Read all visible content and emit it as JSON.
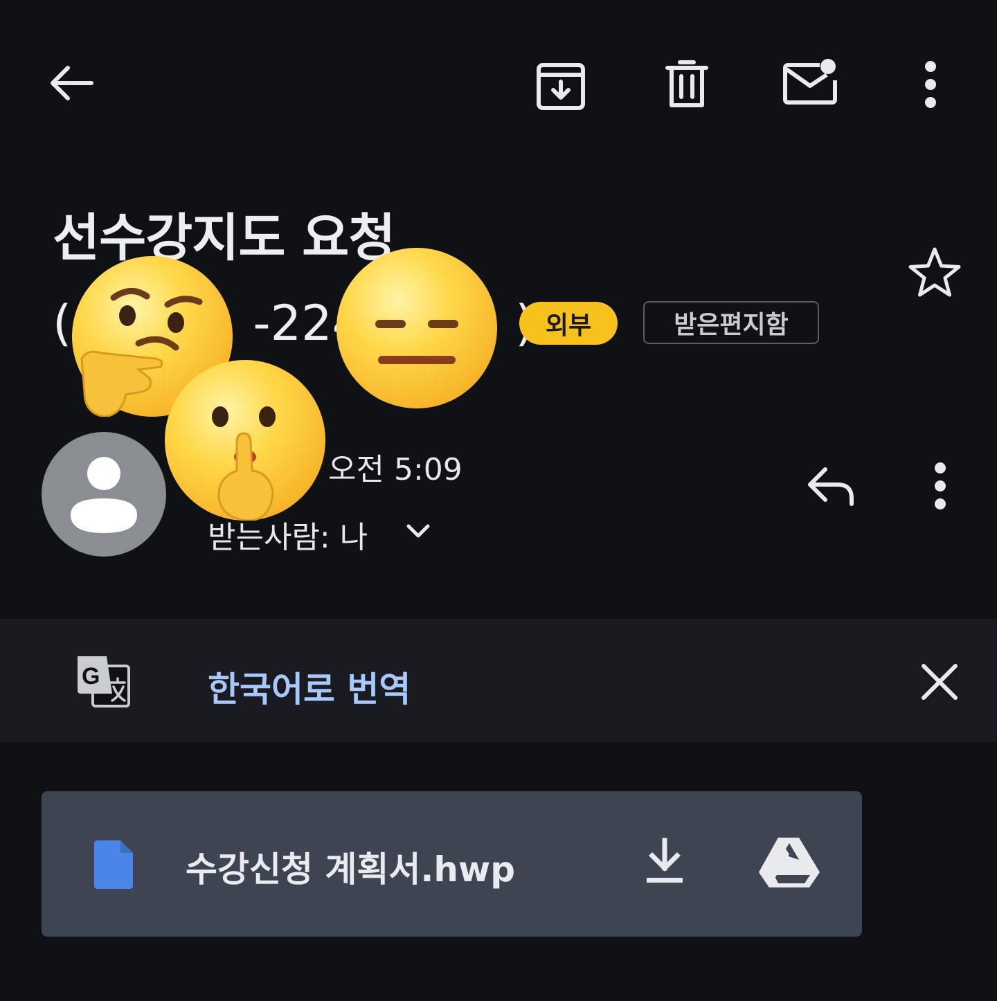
{
  "toolbar": {
    "back_icon": "arrow-back-icon",
    "archive_icon": "archive-icon",
    "delete_icon": "trash-icon",
    "mark_unread_icon": "mark-unread-icon",
    "more_icon": "more-vert-icon"
  },
  "email": {
    "subject_line1": "선수강지도 요청",
    "subject_part_open": "(",
    "subject_part_mid": "-224",
    "subject_part_close": ")",
    "badge_external": "외부",
    "badge_folder": "받은편지함",
    "starred": false
  },
  "message": {
    "time": "오전 5:09",
    "recipient": "받는사람: 나"
  },
  "translate": {
    "label": "한국어로 번역"
  },
  "attachment": {
    "file_name": "수강신청 계획서.hwp"
  },
  "colors": {
    "background": "#0f1115",
    "badge_external": "#f7c21b",
    "link_blue": "#a8c7fa",
    "attachment_bg": "#3f4452",
    "file_icon_blue": "#4a86e8"
  }
}
